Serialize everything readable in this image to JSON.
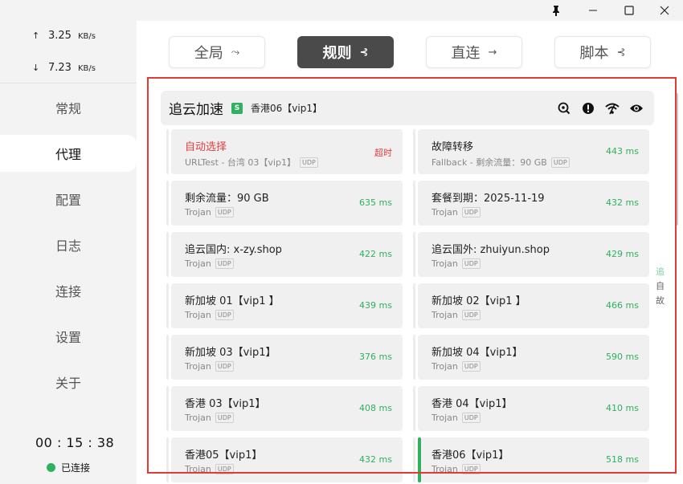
{
  "window": {
    "pin_icon": "pin-icon",
    "minimize_icon": "minimize-icon",
    "maximize_icon": "maximize-icon",
    "close_icon": "close-icon"
  },
  "traffic": {
    "up_value": "3.25",
    "up_unit": "KB/s",
    "down_value": "7.23",
    "down_unit": "KB/s"
  },
  "nav": {
    "items": [
      "常规",
      "代理",
      "配置",
      "日志",
      "连接",
      "设置",
      "关于"
    ],
    "active": "代理"
  },
  "status": {
    "timer": "00 : 15 : 38",
    "connection": "已连接"
  },
  "modes": [
    {
      "label": "全局",
      "icon": "⤳"
    },
    {
      "label": "规则",
      "icon": "⊰"
    },
    {
      "label": "直连",
      "icon": "→"
    },
    {
      "label": "脚本",
      "icon": "⊰"
    }
  ],
  "active_mode": "规则",
  "group": {
    "name": "追云加速",
    "badge": "S",
    "current": "香港06【vip1】"
  },
  "proxies": [
    {
      "name": "自动选择",
      "type": "URLTest - 台湾 03【vip1】",
      "udp": "UDP",
      "latency": "超时",
      "error": true
    },
    {
      "name": "故障转移",
      "type": "Fallback - 剩余流量：90 GB",
      "udp": "UDP",
      "latency": "443 ms"
    },
    {
      "name": "剩余流量：90 GB",
      "type": "Trojan",
      "udp": "UDP",
      "latency": "635 ms"
    },
    {
      "name": "套餐到期：2025-11-19",
      "type": "Trojan",
      "udp": "UDP",
      "latency": "432 ms"
    },
    {
      "name": "追云国内: x-zy.shop",
      "type": "Trojan",
      "udp": "UDP",
      "latency": "422 ms"
    },
    {
      "name": "追云国外: zhuiyun.shop",
      "type": "Trojan",
      "udp": "UDP",
      "latency": "429 ms"
    },
    {
      "name": "新加坡 01【vip1 】",
      "type": "Trojan",
      "udp": "UDP",
      "latency": "439 ms"
    },
    {
      "name": "新加坡 02【vip1 】",
      "type": "Trojan",
      "udp": "UDP",
      "latency": "466 ms"
    },
    {
      "name": "新加坡 03【vip1】",
      "type": "Trojan",
      "udp": "UDP",
      "latency": "376 ms"
    },
    {
      "name": "新加坡 04【vip1】",
      "type": "Trojan",
      "udp": "UDP",
      "latency": "590 ms"
    },
    {
      "name": "香港 03【vip1】",
      "type": "Trojan",
      "udp": "UDP",
      "latency": "408 ms"
    },
    {
      "name": "香港 04【vip1】",
      "type": "Trojan",
      "udp": "UDP",
      "latency": "410 ms"
    },
    {
      "name": "香港05【vip1】",
      "type": "Trojan",
      "udp": "UDP",
      "latency": "432 ms"
    },
    {
      "name": "香港06【vip1】",
      "type": "Trojan",
      "udp": "UDP",
      "latency": "518 ms",
      "selected": true
    }
  ],
  "alpha_index": [
    "追",
    "自",
    "故"
  ],
  "colors": {
    "accent_green": "#2fb160",
    "error_red": "#e03e3e",
    "highlight_red": "#e53935"
  }
}
